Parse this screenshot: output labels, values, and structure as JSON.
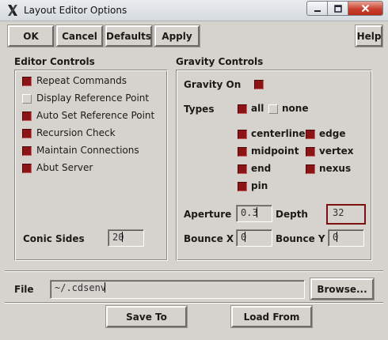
{
  "window": {
    "title": "Layout Editor Options",
    "icons": {
      "app": "x-logo-icon",
      "minimize": "minimize-icon",
      "maximize": "maximize-icon",
      "close": "close-icon"
    }
  },
  "toolbar": {
    "ok": "OK",
    "cancel": "Cancel",
    "defaults": "Defaults",
    "apply": "Apply",
    "help": "Help"
  },
  "editor_controls": {
    "heading": "Editor Controls",
    "options": [
      {
        "label": "Repeat Commands",
        "checked": true
      },
      {
        "label": "Display Reference Point",
        "checked": false
      },
      {
        "label": "Auto Set Reference Point",
        "checked": true
      },
      {
        "label": "Recursion Check",
        "checked": true
      },
      {
        "label": "Maintain Connections",
        "checked": true
      },
      {
        "label": "Abut Server",
        "checked": true
      }
    ],
    "conic_sides_label": "Conic Sides",
    "conic_sides_value": "20"
  },
  "gravity_controls": {
    "heading": "Gravity Controls",
    "gravity_on_label": "Gravity On",
    "gravity_on": true,
    "types_label": "Types",
    "type_all": {
      "label": "all",
      "checked": true
    },
    "type_none": {
      "label": "none",
      "checked": false
    },
    "types": [
      {
        "label": "centerline",
        "checked": true
      },
      {
        "label": "edge",
        "checked": true
      },
      {
        "label": "midpoint",
        "checked": true
      },
      {
        "label": "vertex",
        "checked": true
      },
      {
        "label": "end",
        "checked": true
      },
      {
        "label": "nexus",
        "checked": true
      },
      {
        "label": "pin",
        "checked": true
      }
    ],
    "aperture_label": "Aperture",
    "aperture_value": "0.3",
    "depth_label": "Depth",
    "depth_value": "32",
    "bounce_x_label": "Bounce X",
    "bounce_x_value": "0",
    "bounce_y_label": "Bounce Y",
    "bounce_y_value": "0"
  },
  "file": {
    "label": "File",
    "value": "~/.cdsenv",
    "browse": "Browse...",
    "save_to": "Save To",
    "load_from": "Load From"
  },
  "colors": {
    "checked": "#8c1414",
    "background": "#d6d3ce"
  }
}
